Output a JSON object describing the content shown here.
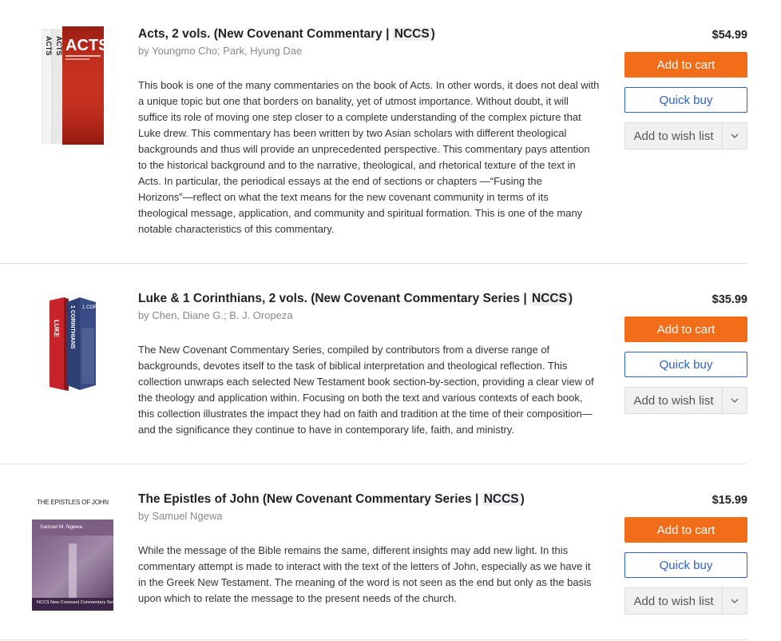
{
  "products": [
    {
      "title_main": "Acts, 2 vols. (New Covenant Commentary | ",
      "title_tag": "NCCS",
      "title_end": ")",
      "author": "by Youngmo Cho; Park, Hyung Dae",
      "description": "This book is one of the many commentaries on the book of Acts. In other words, it does not deal with a unique topic but one that borders on banality, yet of utmost importance. Without doubt, it will suffice its role of moving one step closer to a complete understanding of the complex picture that Luke drew. This commentary has been written by two Asian scholars with different theological backgrounds and thus will provide an unprecedented perspective. This commentary pays attention to the historical background and to the narrative, theological, and rhetorical texture of the text in Acts. In particular, the periodical essays at the end of sections or chapters —“Fusing the Horizons”—reflect on what the text means for the new covenant community in terms of its theological message, application, and community and spiritual formation. This is one of the many notable characteristics of this commentary.",
      "price": "$54.99",
      "cover_text": "ACTS"
    },
    {
      "title_main": "Luke & 1 Corinthians, 2 vols. (New Covenant Commentary Series | ",
      "title_tag": "NCCS",
      "title_end": ")",
      "author": "by Chen, Diane G.; B. J. Oropeza",
      "description": "The New Covenant Commentary Series, compiled by contributors from a diverse range of backgrounds, devotes itself to the task of biblical interpretation and theological reflection. This collection unwraps each selected New Testament book section-by-section, providing a clear view of the theology and application within. Focusing on both the text and various contexts of each book, this collection illustrates the impact they had on faith and tradition at the time of their composition—and the significance they continue to have in contemporary life, faith, and ministry.",
      "price": "$35.99",
      "cover_text_a": "LUKE",
      "cover_text_b": "1 CORINTHIANS"
    },
    {
      "title_main": "The Epistles of John (New Covenant Commentary Series | ",
      "title_tag": "NCCS",
      "title_end": ")",
      "author": "by Samuel Ngewa",
      "description": "While the message of the Bible remains the same, different insights may add new light. In this commentary attempt is made to interact with the text of the letters of John, especially as we have it in the Greek New Testament. The meaning of the word is not seen as the end but only as the basis upon which to relate the message to the present needs of the church.",
      "price": "$15.99",
      "cover_title": "THE EPISTLES OF JOHN",
      "cover_author": "Samuel M. Ngewa",
      "cover_series": "NCCS  New Covenant Commentary Series"
    }
  ],
  "buttons": {
    "add_to_cart": "Add to cart",
    "quick_buy": "Quick buy",
    "add_to_wish_list": "Add to wish list"
  },
  "colors": {
    "add_to_cart_bg": "#f16d1a",
    "quick_buy_border": "#2c62c9"
  },
  "icons": {
    "wish_caret": "chevron-down-icon"
  }
}
